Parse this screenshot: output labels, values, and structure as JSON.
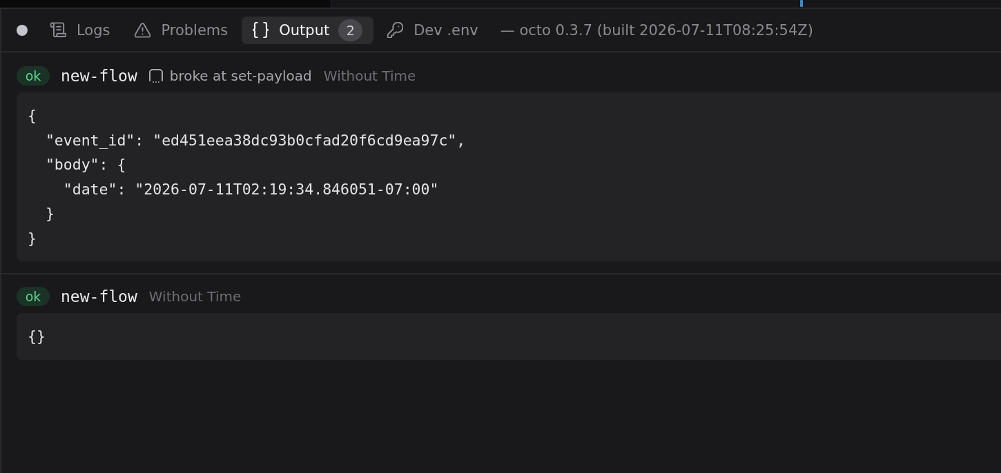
{
  "panel": {
    "tabs": [
      {
        "kind": "logs",
        "label": "Logs",
        "selected": false
      },
      {
        "kind": "problems",
        "label": "Problems",
        "selected": false
      },
      {
        "kind": "output",
        "label": "Output",
        "count": "2",
        "selected": true
      },
      {
        "kind": "env",
        "label": "Dev .env",
        "selected": false
      }
    ],
    "version_text": "— octo 0.3.7 (built 2026-07-11T08:25:54Z)"
  },
  "entries": [
    {
      "badge": {
        "label": "ok",
        "kind": "success"
      },
      "flow": "new-flow",
      "note": "broke at set-payload",
      "time": "Without Time",
      "output": [
        "{",
        "  \"event_id\": \"ed451eea38dc93b0cfad20f6cd9ea97c\",",
        "  \"body\": {",
        "    \"date\": \"2026-07-11T02:19:34.846051-07:00\"",
        "  }",
        "}"
      ]
    },
    {
      "badge": {
        "label": "ok",
        "kind": "success"
      },
      "flow": "new-flow",
      "time": "Without Time",
      "output": [
        "{}"
      ]
    }
  ]
}
